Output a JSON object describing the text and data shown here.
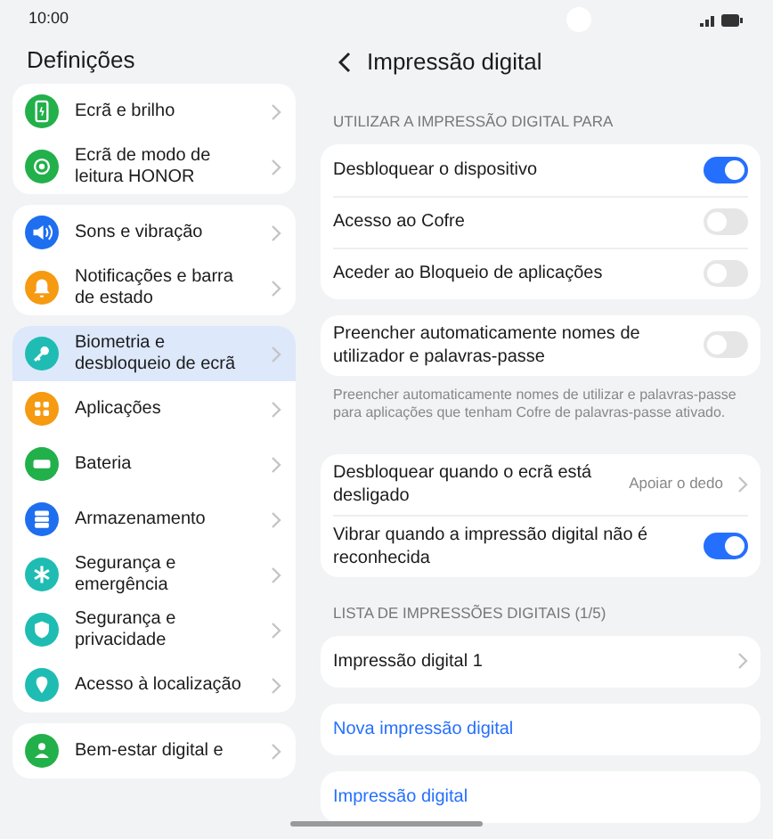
{
  "status_bar": {
    "time": "10:00"
  },
  "sidebar": {
    "title": "Definições",
    "groups": [
      {
        "items": [
          {
            "label": "Ecrã e brilho",
            "kind": "display",
            "color": "#22b04b",
            "selected": false
          },
          {
            "label": "Ecrã de modo de leitura HONOR",
            "kind": "eye",
            "color": "#22b04b",
            "selected": false
          }
        ]
      },
      {
        "items": [
          {
            "label": "Sons e vibração",
            "kind": "sound",
            "color": "#1e6ef0",
            "selected": false
          },
          {
            "label": "Notificações e barra de estado",
            "kind": "bell",
            "color": "#f59a11",
            "selected": false
          }
        ]
      },
      {
        "items": [
          {
            "label": "Biometria e desbloqueio de ecrã",
            "kind": "key",
            "color": "#1fbcb3",
            "selected": true
          },
          {
            "label": "Aplicações",
            "kind": "apps",
            "color": "#f59a11",
            "selected": false
          },
          {
            "label": "Bateria",
            "kind": "battery",
            "color": "#22b04b",
            "selected": false
          },
          {
            "label": "Armazenamento",
            "kind": "storage",
            "color": "#1e6ef0",
            "selected": false
          },
          {
            "label": "Segurança e emergência",
            "kind": "asterisk",
            "color": "#1fbcb3",
            "selected": false
          },
          {
            "label": "Segurança e privacidade",
            "kind": "shield",
            "color": "#1fbcb3",
            "selected": false
          },
          {
            "label": "Acesso à localização",
            "kind": "pin",
            "color": "#1fbcb3",
            "selected": false
          }
        ]
      },
      {
        "items": [
          {
            "label": "Bem-estar digital e",
            "kind": "person",
            "color": "#22b04b",
            "selected": false
          }
        ]
      }
    ]
  },
  "detail": {
    "title": "Impressão digital",
    "sections": [
      {
        "header": "UTILIZAR A IMPRESSÃO DIGITAL PARA",
        "cards": [
          {
            "rows": [
              {
                "kind": "toggle",
                "label": "Desbloquear o dispositivo",
                "on": true
              },
              {
                "kind": "toggle",
                "label": "Acesso ao Cofre",
                "on": false
              },
              {
                "kind": "toggle",
                "label": "Aceder ao Bloqueio de aplicações",
                "on": false
              }
            ]
          },
          {
            "rows": [
              {
                "kind": "toggle",
                "label": "Preencher automaticamente nomes de utilizador e palavras-passe",
                "on": false
              }
            ],
            "note": "Preencher automaticamente nomes de utilizar e palavras-passe para aplicações que tenham Cofre de palavras-passe ativado."
          },
          {
            "rows": [
              {
                "kind": "value",
                "label": "Desbloquear quando o ecrã está desligado",
                "value": "Apoiar o dedo"
              },
              {
                "kind": "toggle",
                "label": "Vibrar quando a impressão digital não é reconhecida",
                "on": true
              }
            ]
          }
        ]
      },
      {
        "header": "LISTA DE IMPRESSÕES DIGITAIS (1/5)",
        "cards": [
          {
            "rows": [
              {
                "kind": "nav",
                "label": "Impressão digital 1"
              }
            ]
          },
          {
            "rows": [
              {
                "kind": "link",
                "label": "Nova impressão digital"
              }
            ]
          },
          {
            "rows": [
              {
                "kind": "link",
                "label": "Impressão digital"
              }
            ]
          }
        ]
      }
    ]
  }
}
